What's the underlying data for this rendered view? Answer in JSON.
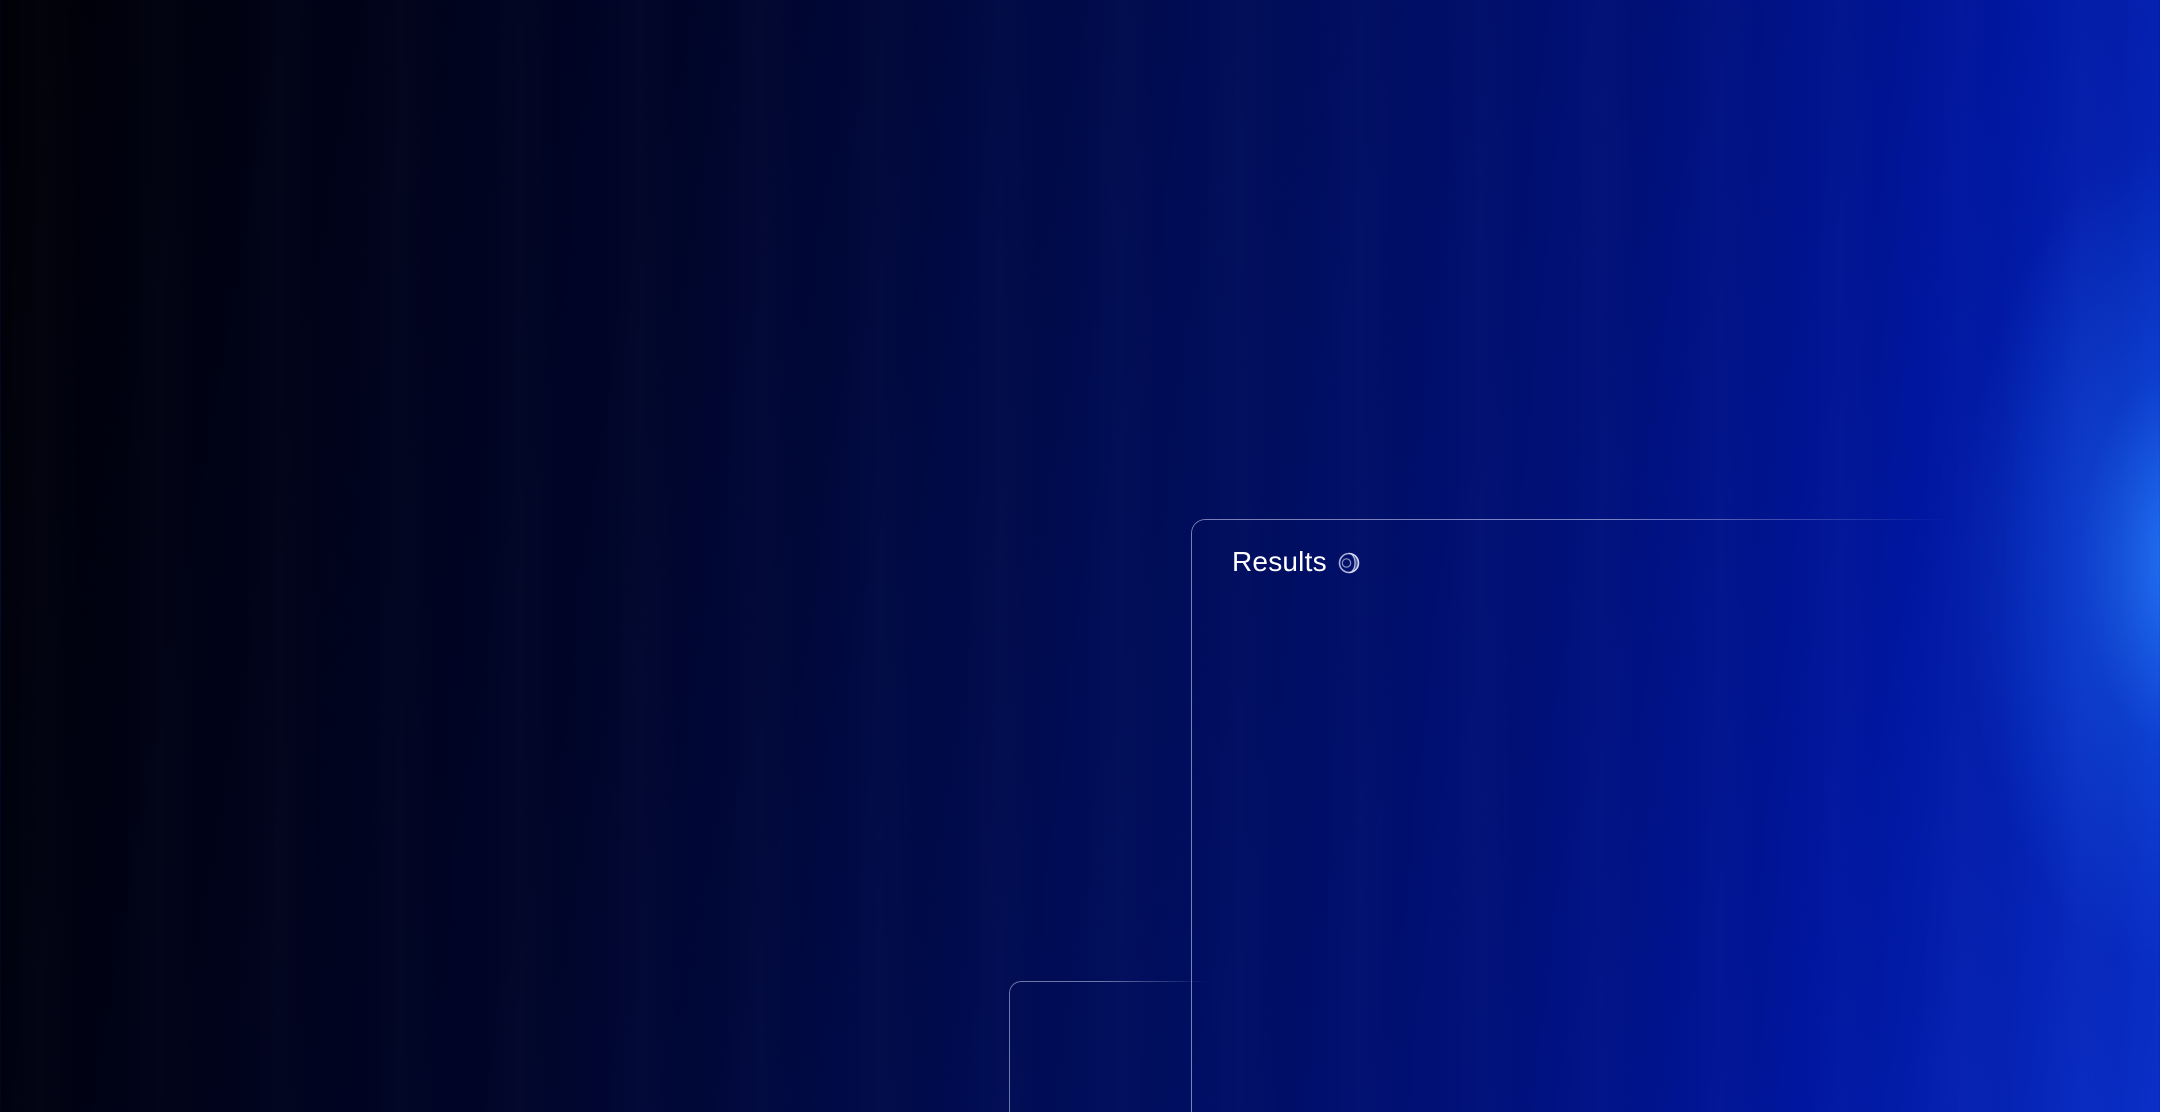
{
  "results_panel": {
    "title": "Results",
    "status_icon": "loading-spinner-icon"
  },
  "colors": {
    "background_dark": "#000006",
    "background_mid": "#000c52",
    "background_bright": "#0a2fc8",
    "glow": "#2882ff",
    "panel_border": "#dce1ff"
  }
}
